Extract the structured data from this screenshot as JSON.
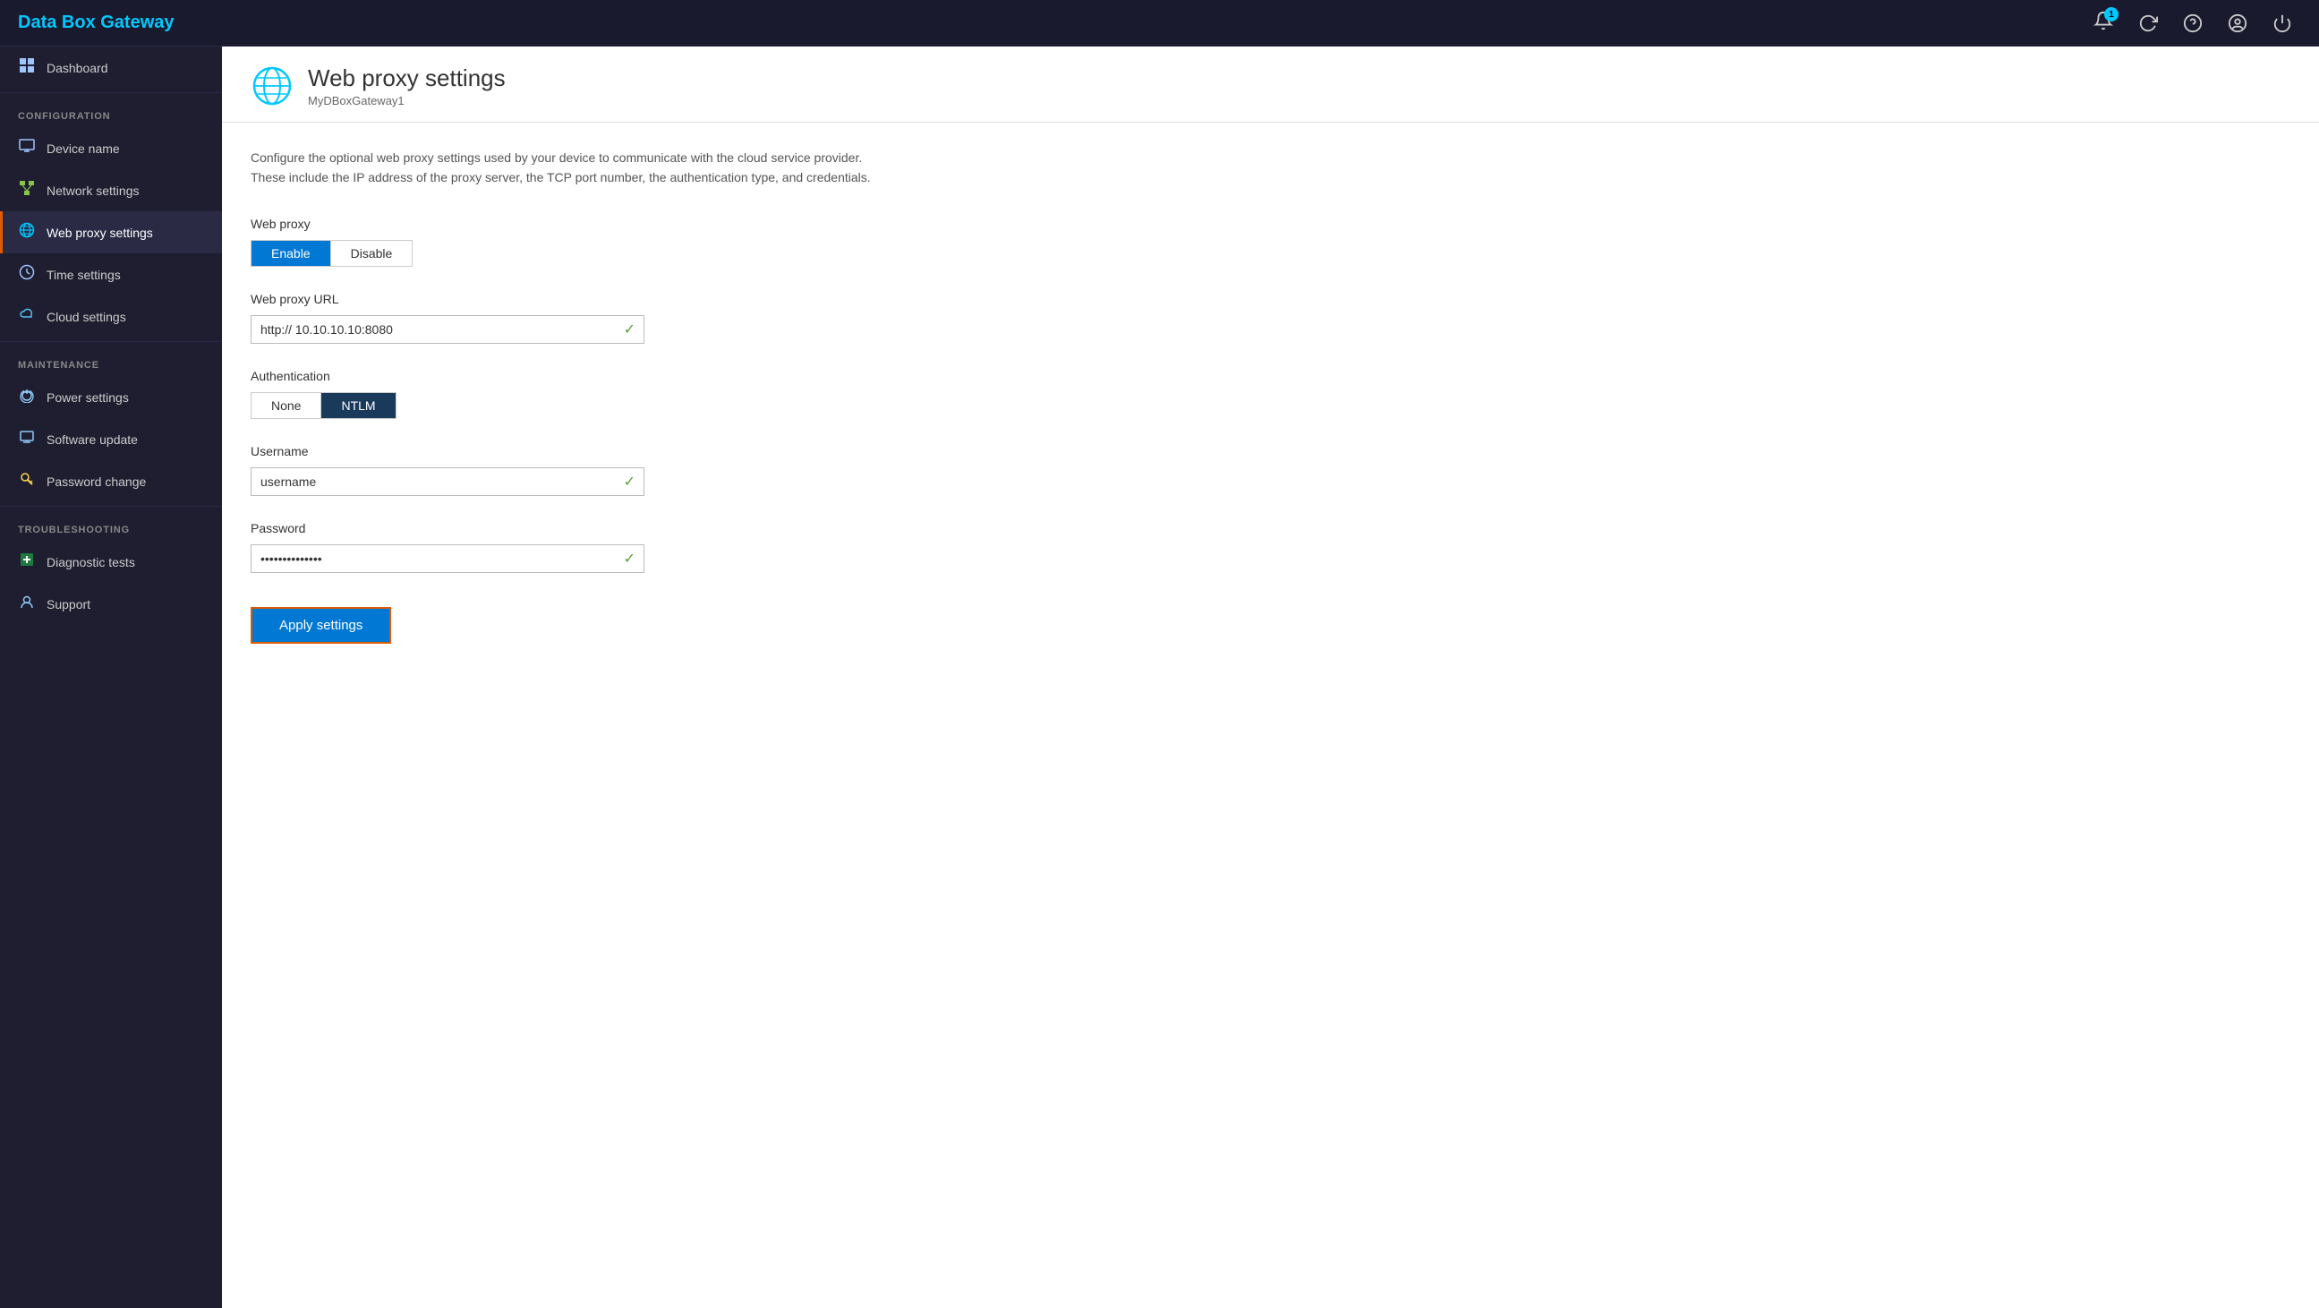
{
  "app": {
    "title": "Data Box Gateway",
    "notification_count": "1"
  },
  "sidebar": {
    "dashboard_label": "Dashboard",
    "config_section": "CONFIGURATION",
    "device_name_label": "Device name",
    "network_settings_label": "Network settings",
    "web_proxy_label": "Web proxy settings",
    "time_settings_label": "Time settings",
    "cloud_settings_label": "Cloud settings",
    "maintenance_section": "MAINTENANCE",
    "power_settings_label": "Power settings",
    "software_update_label": "Software update",
    "password_change_label": "Password change",
    "troubleshooting_section": "TROUBLESHOOTING",
    "diagnostic_tests_label": "Diagnostic tests",
    "support_label": "Support"
  },
  "page": {
    "title": "Web proxy settings",
    "subtitle": "MyDBoxGateway1",
    "description_line1": "Configure the optional web proxy settings used by your device to communicate with the cloud service provider.",
    "description_line2": "These include the IP address of the proxy server, the TCP port  number, the authentication type, and credentials.",
    "web_proxy_label": "Web proxy",
    "enable_label": "Enable",
    "disable_label": "Disable",
    "web_proxy_url_label": "Web proxy URL",
    "url_value": "http:// 10.10.10.10:8080",
    "authentication_label": "Authentication",
    "none_label": "None",
    "ntlm_label": "NTLM",
    "username_label": "Username",
    "username_value": "username",
    "password_label": "Password",
    "password_value": "••••••••••••••",
    "apply_button_label": "Apply settings"
  },
  "icons": {
    "bell": "🔔",
    "refresh": "↺",
    "question": "?",
    "user_circle": "○",
    "power": "⏻",
    "check": "✓",
    "grid": "⊞",
    "globe": "🌐",
    "time": "🕐",
    "cloud": "☁",
    "settings_gear": "⚙",
    "computer": "🖥",
    "network": "🔗",
    "key": "🔑",
    "monitor": "📺",
    "person": "👤",
    "wrench": "🔧",
    "plus_square": "⊞"
  }
}
